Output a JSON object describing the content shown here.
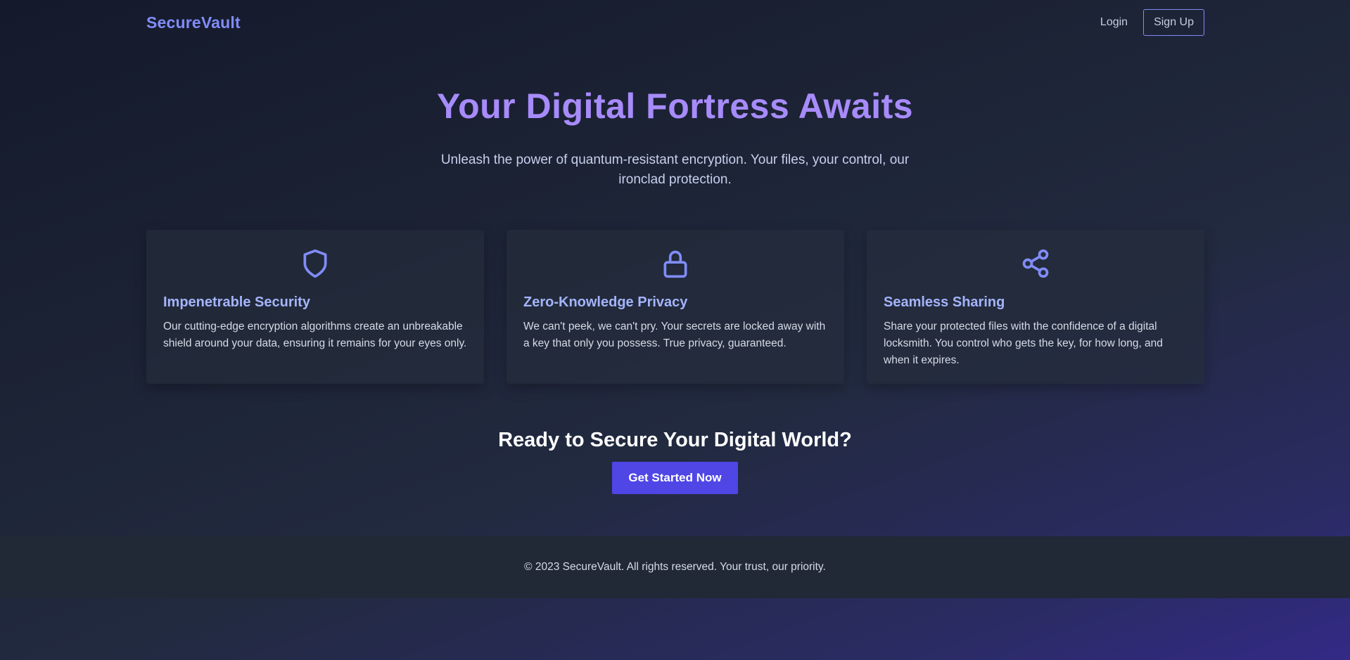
{
  "nav": {
    "brand": "SecureVault",
    "login_label": "Login",
    "signup_label": "Sign Up"
  },
  "hero": {
    "title": "Your Digital Fortress Awaits",
    "subtitle": "Unleash the power of quantum-resistant encryption. Your files, your control, our ironclad protection."
  },
  "features": [
    {
      "icon": "shield-icon",
      "title": "Impenetrable Security",
      "text": "Our cutting-edge encryption algorithms create an unbreakable shield around your data, ensuring it remains for your eyes only."
    },
    {
      "icon": "lock-icon",
      "title": "Zero-Knowledge Privacy",
      "text": "We can't peek, we can't pry. Your secrets are locked away with a key that only you possess. True privacy, guaranteed."
    },
    {
      "icon": "share-icon",
      "title": "Seamless Sharing",
      "text": "Share your protected files with the confidence of a digital locksmith. You control who gets the key, for how long, and when it expires."
    }
  ],
  "cta": {
    "title": "Ready to Secure Your Digital World?",
    "button_label": "Get Started Now"
  },
  "footer": {
    "text": "© 2023 SecureVault. All rights reserved. Your trust, our priority."
  },
  "colors": {
    "accent": "#818cf8",
    "hero_title": "#a78bfa",
    "button": "#4f46e5"
  }
}
